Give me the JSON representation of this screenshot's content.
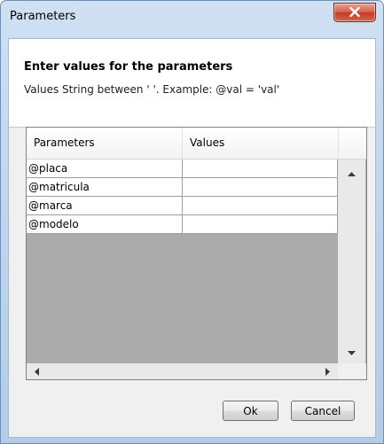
{
  "window": {
    "title": "Parameters"
  },
  "header": {
    "heading": "Enter values for the parameters",
    "hint": "Values String between ' '. Example: @val = 'val'"
  },
  "grid": {
    "columns": [
      "Parameters",
      "Values"
    ],
    "rows": [
      {
        "parameter": "@placa",
        "value": ""
      },
      {
        "parameter": "@matricula",
        "value": ""
      },
      {
        "parameter": "@marca",
        "value": ""
      },
      {
        "parameter": "@modelo",
        "value": ""
      }
    ]
  },
  "buttons": {
    "ok": "Ok",
    "cancel": "Cancel"
  },
  "icons": {
    "close": "close-icon",
    "scroll_up": "triangle-up",
    "scroll_down": "triangle-down",
    "scroll_left": "triangle-left",
    "scroll_right": "triangle-right"
  }
}
